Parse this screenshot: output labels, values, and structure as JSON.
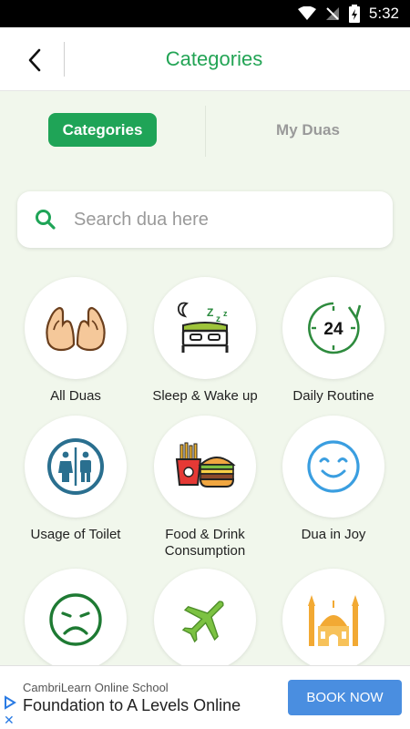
{
  "status_bar": {
    "time": "5:32"
  },
  "app_bar": {
    "title": "Categories"
  },
  "segments": {
    "active": "Categories",
    "inactive": "My Duas"
  },
  "search": {
    "placeholder": "Search dua here"
  },
  "categories": [
    {
      "label": "All Duas",
      "icon": "praying-hands-icon"
    },
    {
      "label": "Sleep & Wake up",
      "icon": "bed-icon"
    },
    {
      "label": "Daily Routine",
      "icon": "clock-24-icon"
    },
    {
      "label": "Usage of Toilet",
      "icon": "toilet-icon"
    },
    {
      "label": "Food & Drink Consumption",
      "icon": "food-icon"
    },
    {
      "label": "Dua in Joy",
      "icon": "smile-icon"
    },
    {
      "label": "",
      "icon": "sad-face-icon"
    },
    {
      "label": "",
      "icon": "airplane-icon"
    },
    {
      "label": "",
      "icon": "mosque-icon"
    }
  ],
  "ad": {
    "sponsor": "CambriLearn Online School",
    "headline": "Foundation to A Levels Online",
    "cta": "BOOK NOW"
  },
  "colors": {
    "accent": "#1fa457",
    "background": "#f1f7ec",
    "ad_button": "#4a8ee0"
  }
}
